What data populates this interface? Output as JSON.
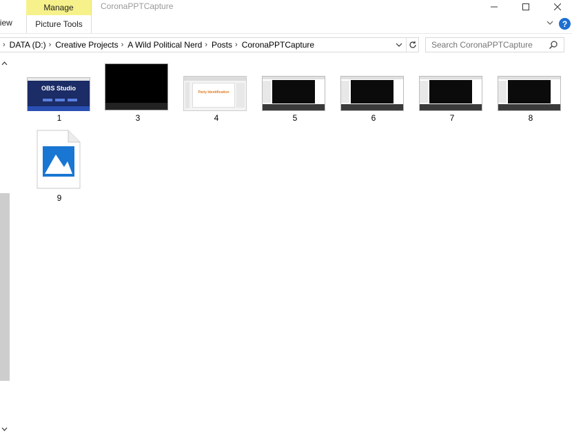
{
  "ribbon": {
    "manage_label": "Manage",
    "picture_tools_label": "Picture Tools",
    "view_label": "View",
    "window_title": "CoronaPPTCapture",
    "help_label": "?"
  },
  "address": {
    "crumbs": [
      "DATA (D:)",
      "Creative Projects",
      "A Wild Political Nerd",
      "Posts",
      "CoronaPPTCapture"
    ]
  },
  "search": {
    "placeholder": "Search CoronaPPTCapture"
  },
  "files": [
    {
      "name": "1",
      "kind": "obs-screenshot",
      "thumb_title": "OBS Studio"
    },
    {
      "name": "3",
      "kind": "black"
    },
    {
      "name": "4",
      "kind": "powerpoint",
      "thumb_title": "Party Identification"
    },
    {
      "name": "5",
      "kind": "obs-dark"
    },
    {
      "name": "6",
      "kind": "obs-dark"
    },
    {
      "name": "7",
      "kind": "obs-dark"
    },
    {
      "name": "8",
      "kind": "obs-dark"
    },
    {
      "name": "9",
      "kind": "image-file-icon"
    }
  ],
  "colors": {
    "manage_tab": "#f6f18b",
    "accent_blue": "#1e6fd0",
    "image_icon_blue": "#1976d2"
  }
}
